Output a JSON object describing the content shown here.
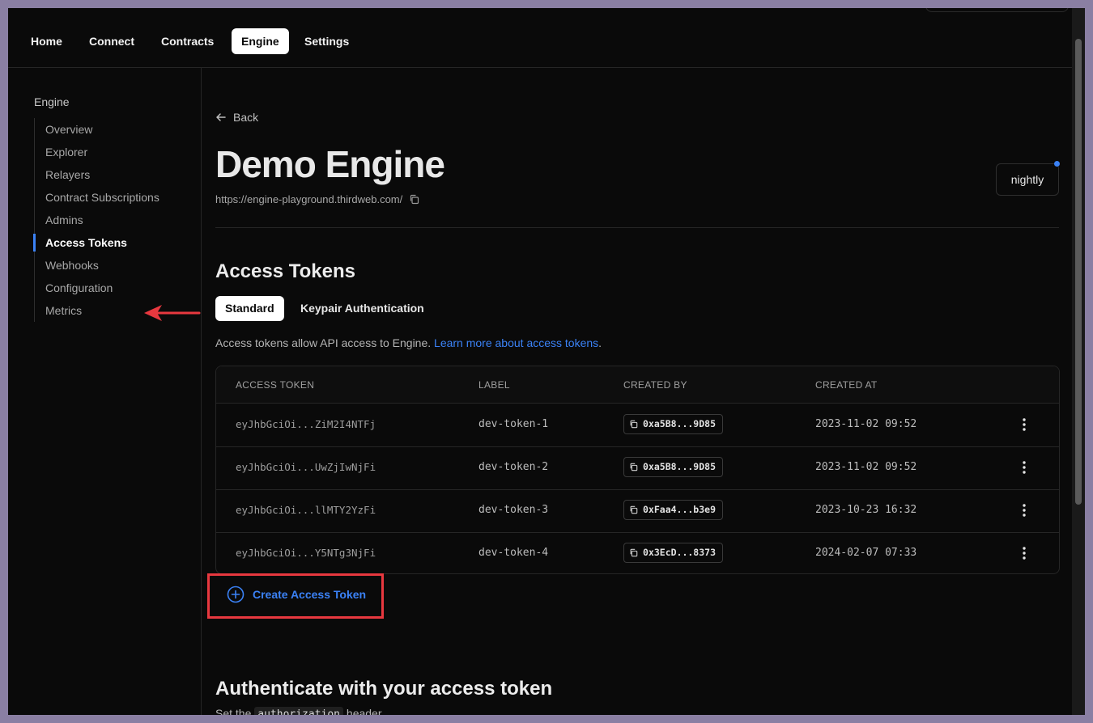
{
  "topnav": {
    "tabs": [
      {
        "label": "Home",
        "active": false
      },
      {
        "label": "Connect",
        "active": false
      },
      {
        "label": "Contracts",
        "active": false
      },
      {
        "label": "Engine",
        "active": true
      },
      {
        "label": "Settings",
        "active": false
      }
    ]
  },
  "sidebar": {
    "heading": "Engine",
    "items": [
      {
        "label": "Overview"
      },
      {
        "label": "Explorer"
      },
      {
        "label": "Relayers"
      },
      {
        "label": "Contract Subscriptions"
      },
      {
        "label": "Admins"
      },
      {
        "label": "Access Tokens",
        "active": true
      },
      {
        "label": "Webhooks"
      },
      {
        "label": "Configuration"
      },
      {
        "label": "Metrics"
      }
    ]
  },
  "header": {
    "back_label": "Back",
    "title": "Demo Engine",
    "url": "https://engine-playground.thirdweb.com/",
    "version_badge": "nightly"
  },
  "access_tokens": {
    "heading": "Access Tokens",
    "tabs": [
      {
        "label": "Standard",
        "active": true
      },
      {
        "label": "Keypair Authentication",
        "active": false
      }
    ],
    "description": "Access tokens allow API access to Engine. ",
    "learn_more_link": "Learn more about access tokens",
    "description_end": ".",
    "table": {
      "columns": [
        "ACCESS TOKEN",
        "LABEL",
        "CREATED BY",
        "CREATED AT"
      ],
      "rows": [
        {
          "token": "eyJhbGciOi...ZiM2I4NTFj",
          "label": "dev-token-1",
          "created_by": "0xa5B8...9D85",
          "created_at": "2023-11-02 09:52"
        },
        {
          "token": "eyJhbGciOi...UwZjIwNjFi",
          "label": "dev-token-2",
          "created_by": "0xa5B8...9D85",
          "created_at": "2023-11-02 09:52"
        },
        {
          "token": "eyJhbGciOi...llMTY2YzFi",
          "label": "dev-token-3",
          "created_by": "0xFaa4...b3e9",
          "created_at": "2023-10-23 16:32"
        },
        {
          "token": "eyJhbGciOi...Y5NTg3NjFi",
          "label": "dev-token-4",
          "created_by": "0x3EcD...8373",
          "created_at": "2024-02-07 07:33"
        }
      ]
    },
    "create_button": "Create Access Token"
  },
  "authenticate": {
    "heading": "Authenticate with your access token",
    "line_prefix": "Set the",
    "header_name": "authorization",
    "line_suffix": "header."
  },
  "colors": {
    "accent": "#3b82f6",
    "highlight": "#e8383f",
    "background": "#0a0a0a"
  },
  "icons": [
    "arrow-left-icon",
    "copy-icon",
    "plus-circle-icon",
    "more-vertical-icon",
    "annotation-arrow"
  ]
}
